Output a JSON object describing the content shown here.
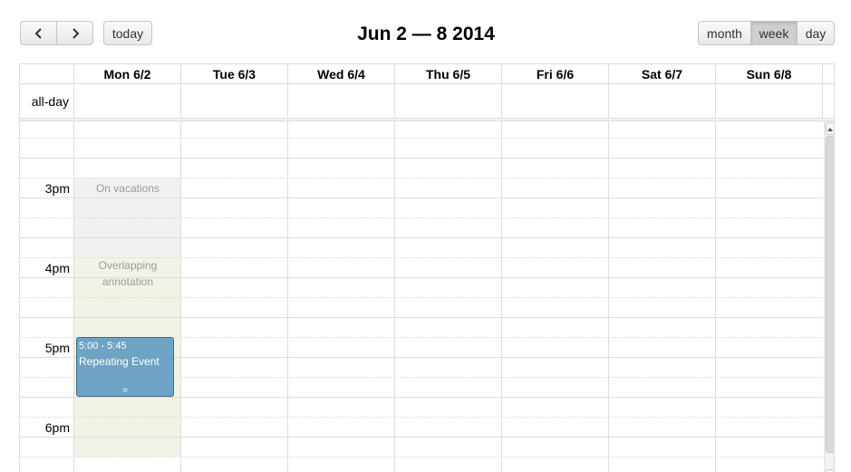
{
  "toolbar": {
    "prev_icon": "chevron-left-icon",
    "next_icon": "chevron-right-icon",
    "today_label": "today",
    "title": "Jun 2 — 8 2014",
    "views": {
      "month": "month",
      "week": "week",
      "day": "day"
    },
    "active_view": "week"
  },
  "columns": {
    "mon": "Mon 6/2",
    "tue": "Tue 6/3",
    "wed": "Wed 6/4",
    "thu": "Thu 6/5",
    "fri": "Fri 6/6",
    "sat": "Sat 6/7",
    "sun": "Sun 6/8"
  },
  "allday_label": "all-day",
  "time_labels": {
    "t3": "3pm",
    "t4": "4pm",
    "t5": "5pm",
    "t6": "6pm"
  },
  "background_events": {
    "vacation": "On vacations",
    "overlap": "Overlapping annotation"
  },
  "event": {
    "time": "5:00 - 5:45",
    "title": "Repeating Event",
    "resize_handle": "="
  },
  "colors": {
    "event_bg": "#6fa3c4",
    "vacation_bg": "#f1f1f3",
    "overlap_bg": "#f2f2e6",
    "active_button": "#cfcfcf"
  }
}
